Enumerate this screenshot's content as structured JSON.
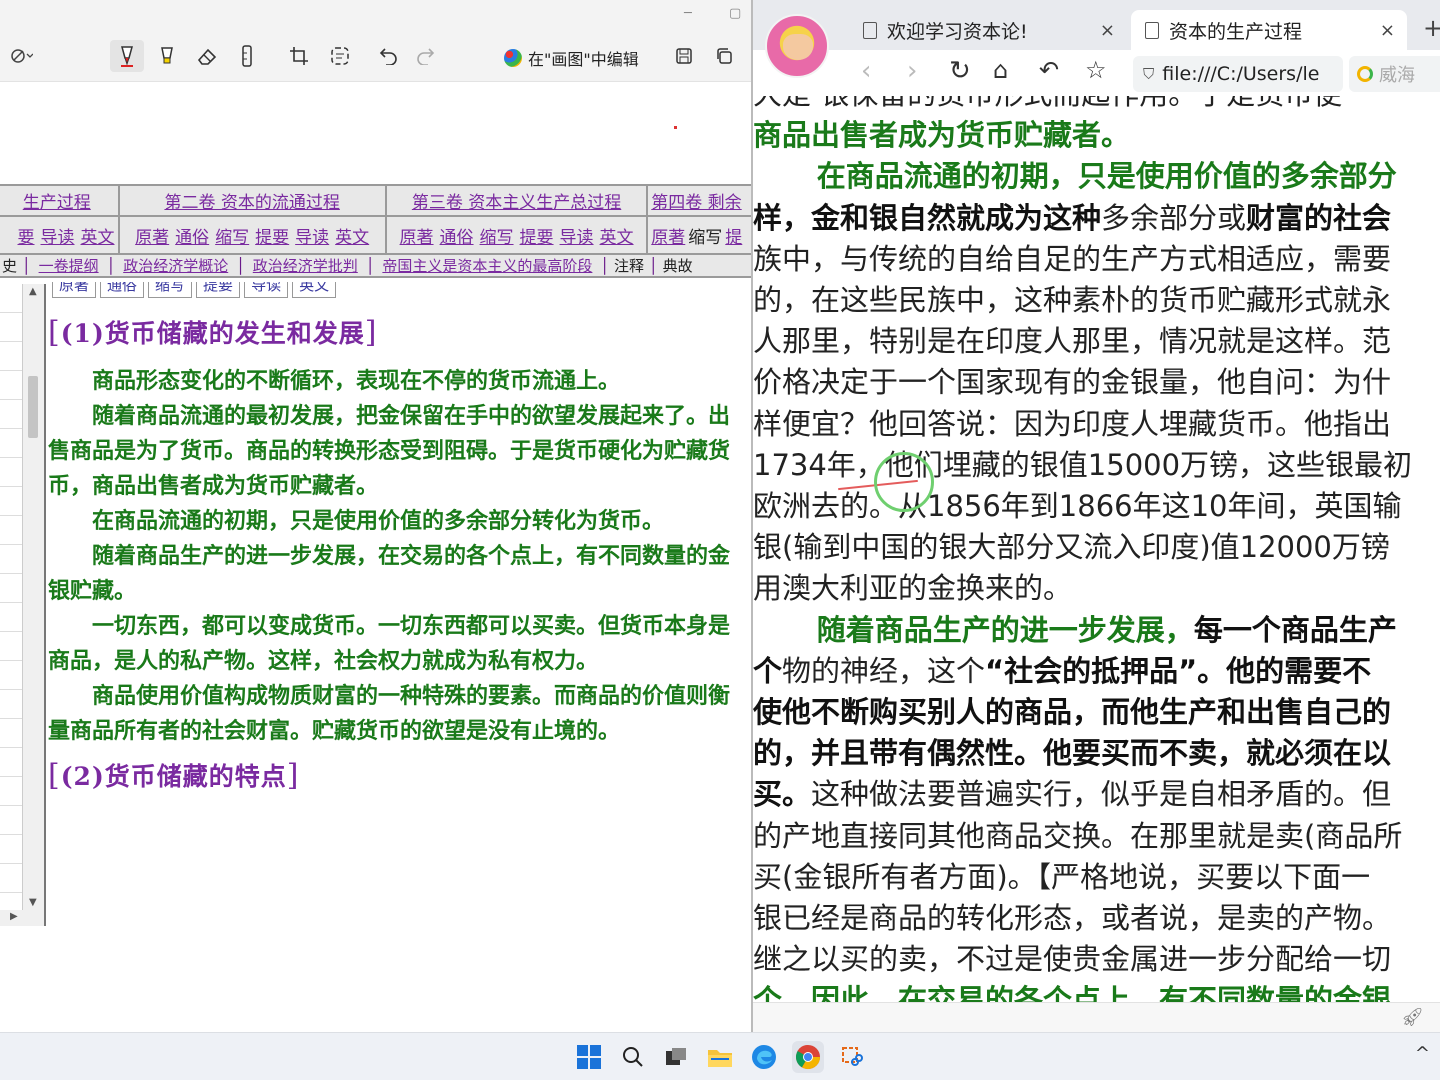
{
  "snip_tool": {
    "window_controls": [
      "─",
      "▢"
    ],
    "toolbar": {
      "touch_icon": "touch-writing-icon",
      "tools": [
        "ballpoint-pen-icon",
        "highlighter-icon",
        "eraser-icon",
        "ruler-icon",
        "crop-icon",
        "text-actions-icon",
        "undo-icon",
        "redo-icon"
      ],
      "paint_edit_label": "在\"画图\"中编辑",
      "save_icon": "save-icon",
      "copy_icon": "copy-icon"
    }
  },
  "nav_table": {
    "row1": [
      "生产过程",
      "第二卷 资本的流通过程",
      "第三卷 资本主义生产总过程",
      "第四卷 剩余"
    ],
    "row2_links": [
      "要",
      "导读",
      "英文"
    ],
    "row2_group": [
      "原著",
      "通俗",
      "缩写",
      "提要",
      "导读",
      "英文"
    ],
    "row2_last": [
      "原著",
      "缩写",
      "提"
    ],
    "row3": [
      "史",
      "一卷提纲",
      "政治经济学概论",
      "政治经济学批判",
      "帝国主义是资本主义的最高阶段",
      "注释",
      "典故"
    ]
  },
  "sub_tabs": [
    "原著",
    "通俗",
    "缩写",
    "提要",
    "导读",
    "英文"
  ],
  "left_doc": {
    "heading1": "(1)货币储藏的发生和发展",
    "paragraphs": [
      "商品形态变化的不断循环，表现在不停的货币流通上。",
      "随着商品流通的最初发展，把金保留在手中的欲望发展起来了。出售商品是为了货币。商品的转换形态受到阻碍。于是货币硬化为贮藏货币，商品出售者成为货币贮藏者。",
      "在商品流通的初期，只是使用价值的多余部分转化为货币。",
      "随着商品生产的进一步发展，在交易的各个点上，有不同数量的金银贮藏。",
      "一切东西，都可以变成货币。一切东西都可以买卖。但货币本身是商品，是人的私产物。这样，社会权力就成为私有权力。",
      "商品使用价值构成物质财富的一种特殊的要素。而商品的价值则衡量商品所有者的社会财富。贮藏货币的欲望是没有止境的。"
    ],
    "heading2": "(2)货币储藏的特点"
  },
  "browser": {
    "tabs": [
      {
        "label": "欢迎学习资本论!",
        "active": false
      },
      {
        "label": "资本的生产过程",
        "active": true
      }
    ],
    "new_tab": "+",
    "close_glyph": "×",
    "address": "file:///C:/Users/le",
    "search_chip": "威海"
  },
  "right_doc": {
    "lines": [
      [
        {
          "t": "大是 银保留的货币形式而起作用。于是货币便",
          "s": "n"
        }
      ],
      [
        {
          "t": "商品出售者成为货币贮藏者。",
          "s": "g"
        }
      ],
      [
        {
          "t": "在商品流通的初期，只是使用价值的多余部分",
          "s": "g"
        }
      ],
      [
        {
          "t": "样，金和银自然就成为这种",
          "s": "b"
        },
        {
          "t": "多余部分或",
          "s": "n"
        },
        {
          "t": "财富的社会",
          "s": "b"
        }
      ],
      [
        {
          "t": "族中，与传统的自给自足的生产方式相适应，需要",
          "s": "n"
        }
      ],
      [
        {
          "t": "的，在这些民族中，这种素朴的货币贮藏形式就永",
          "s": "n"
        }
      ],
      [
        {
          "t": "人那里，特别是在印度人那里，情况就是这样。范",
          "s": "n"
        }
      ],
      [
        {
          "t": "价格决定于一个国家现有的金银量，他自问：为什",
          "s": "n"
        }
      ],
      [
        {
          "t": "样便宜？他回答说：因为印度人埋藏货币。他指出",
          "s": "n"
        }
      ],
      [
        {
          "t": "1734年，他们埋藏的银值15000万镑，这些银最初",
          "s": "n"
        }
      ],
      [
        {
          "t": "欧洲去的。从1856年到1866年这10年间，英国输",
          "s": "n"
        }
      ],
      [
        {
          "t": "银(输到中国的银大部分又流入印度)值12000万镑",
          "s": "n"
        }
      ],
      [
        {
          "t": "用澳大利亚的金换来的。",
          "s": "n"
        }
      ],
      [
        {
          "t": "随着商品生产的进一步发展，",
          "s": "g"
        },
        {
          "t": "每一个商品生产",
          "s": "b"
        }
      ],
      [
        {
          "t": "个",
          "s": "b"
        },
        {
          "t": "物的神经，这个",
          "s": "n"
        },
        {
          "t": "“社会的抵押品”。他的需要不",
          "s": "b"
        }
      ],
      [
        {
          "t": "使他不断购买别人的商品，而他生产和出售自己的",
          "s": "b"
        }
      ],
      [
        {
          "t": "的，并且带有偶然性。他要买而不卖，就必须在以",
          "s": "b"
        }
      ],
      [
        {
          "t": "买。",
          "s": "b"
        },
        {
          "t": "这种做法要普遍实行，似乎是自相矛盾的。但",
          "s": "n"
        }
      ],
      [
        {
          "t": "的产地直接同其他商品交换。在那里就是卖(商品所",
          "s": "n"
        }
      ],
      [
        {
          "t": "买(金银所有者方面)。【严格地说，买要以下面一",
          "s": "n"
        }
      ],
      [
        {
          "t": "银已经是商品的转化形态，或者说，是卖的产物。",
          "s": "n"
        }
      ],
      [
        {
          "t": "继之以买的卖，不过是使贵金属进一步分配给一切",
          "s": "n"
        }
      ],
      [
        {
          "t": "个。因此，在交易的各个点上，有不同数量的金银",
          "s": "g"
        }
      ]
    ],
    "indent_lines": [
      2,
      13
    ]
  },
  "taskbar": {
    "apps": [
      "start-icon",
      "search-icon",
      "task-view-icon",
      "file-explorer-icon",
      "edge-icon",
      "chrome-icon",
      "snipping-tool-icon"
    ],
    "tray_chevron": "^"
  }
}
